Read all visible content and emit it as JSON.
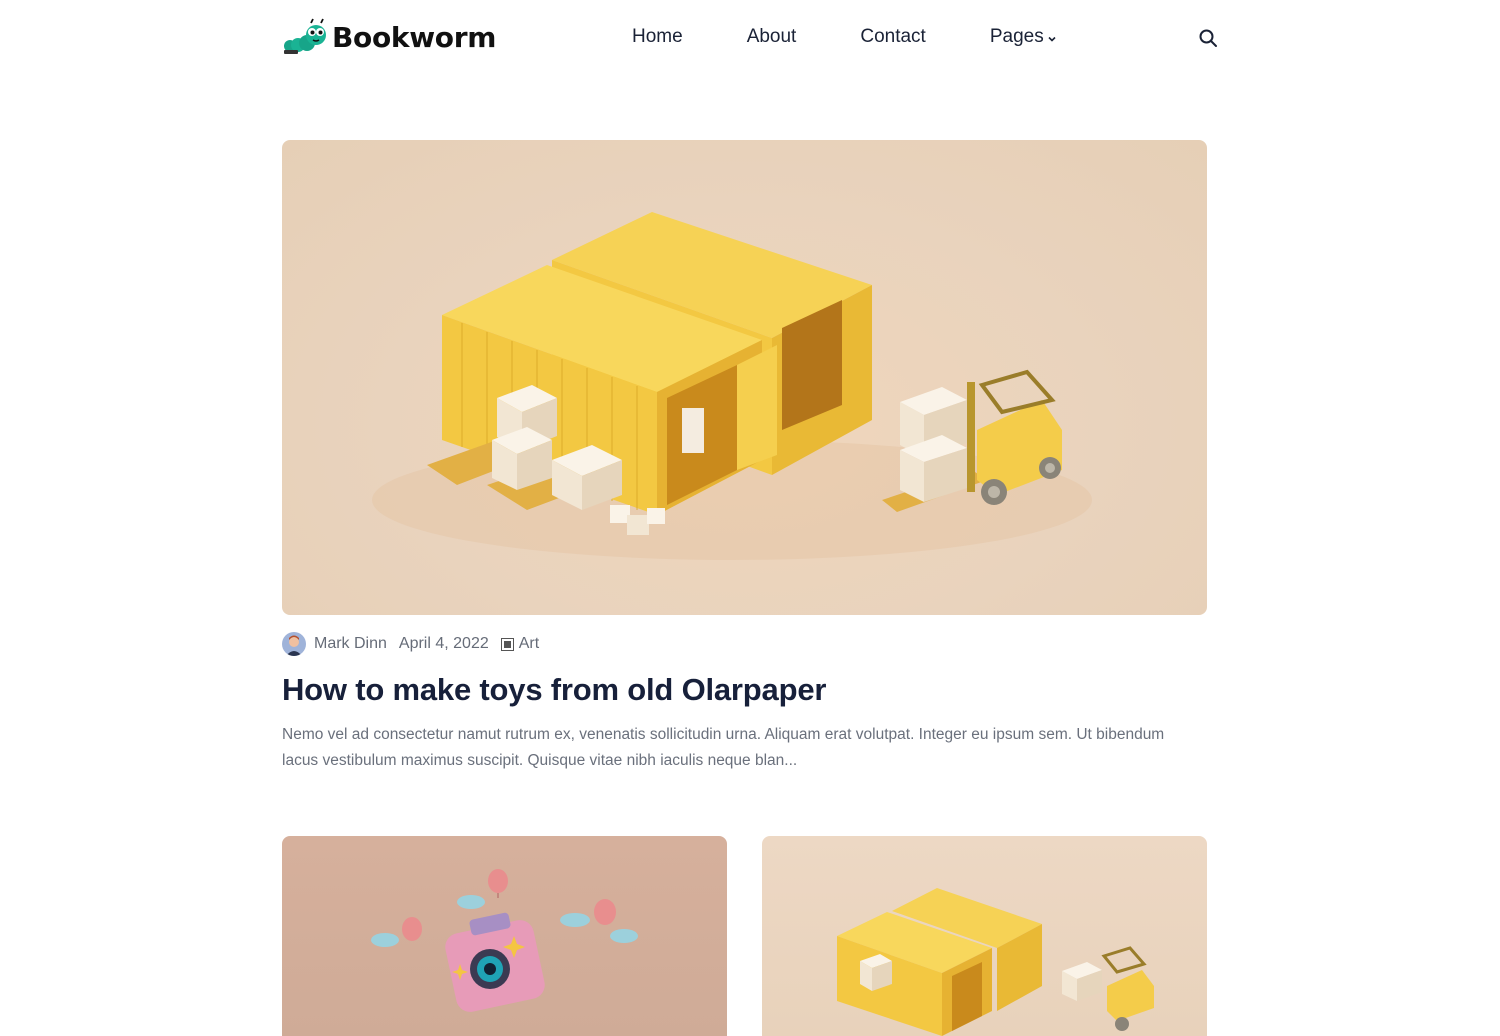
{
  "brand": {
    "name": "Bookworm"
  },
  "nav": {
    "items": [
      {
        "label": "Home"
      },
      {
        "label": "About"
      },
      {
        "label": "Contact"
      },
      {
        "label": "Pages"
      }
    ],
    "search_icon": "search-icon"
  },
  "featured_post": {
    "image": "yellow-shipping-containers-forklift",
    "author": "Mark Dinn",
    "date": "April 4, 2022",
    "category": "Art",
    "title": "How to make toys from old Olarpaper",
    "excerpt": "Nemo vel ad consectetur namut rutrum ex, venenatis sollicitudin urna. Aliquam erat volutpat. Integer eu ipsum sem. Ut bibendum lacus vestibulum maximus suscipit. Quisque vitae nibh iaculis neque blan..."
  },
  "cards": [
    {
      "image": "pink-camera-balloons"
    },
    {
      "image": "yellow-shipping-containers-forklift"
    }
  ],
  "colors": {
    "heading": "#17203a",
    "body_text": "#6a707c",
    "logo_accent": "#17a589",
    "container_yellow": "#f3c842"
  }
}
